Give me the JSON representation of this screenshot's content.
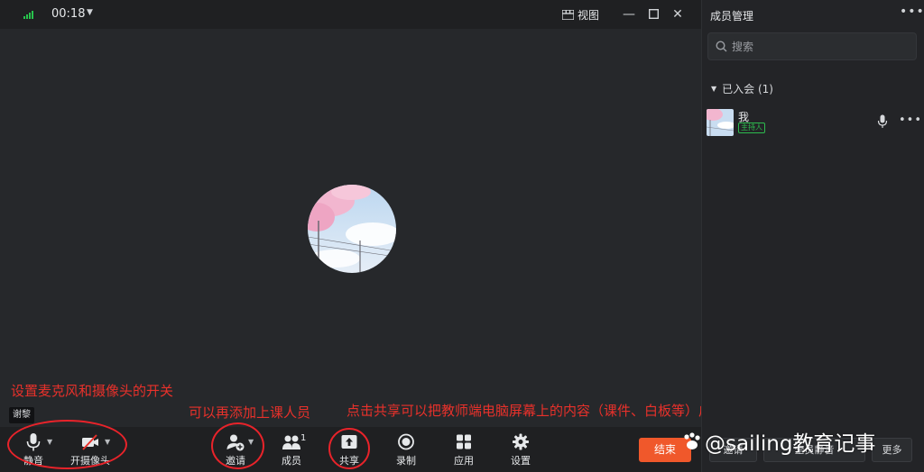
{
  "topbar": {
    "timer": "00:18",
    "view_label": "视图"
  },
  "video": {
    "name_tag": "谢黎"
  },
  "annotations": {
    "mic_camera_note": "设置麦克风和摄像头的开关",
    "invite_note": "可以再添加上课人员",
    "share_note": "点击共享可以把教师端电脑屏幕上的内容（课件、白板等）广播到学生端"
  },
  "toolbar": {
    "mute_label": "静音",
    "camera_label": "开摄像头",
    "invite_label": "邀请",
    "members_label": "成员",
    "members_count": "1",
    "share_label": "共享",
    "record_label": "录制",
    "apps_label": "应用",
    "settings_label": "设置",
    "end_label": "结束"
  },
  "panel": {
    "title": "成员管理",
    "search_placeholder": "搜索",
    "group_label": "已入会 (1)",
    "members": [
      {
        "name": "我",
        "badge": "主持人"
      }
    ],
    "invite_button": "邀请",
    "mute_all_button": "全员静音",
    "more_button": "更多"
  },
  "watermark": {
    "text": "@sailing教育记事"
  },
  "colors": {
    "accent_end": "#f0582b",
    "annotation_red": "#e8312b",
    "host_green": "#2dbb4e"
  }
}
